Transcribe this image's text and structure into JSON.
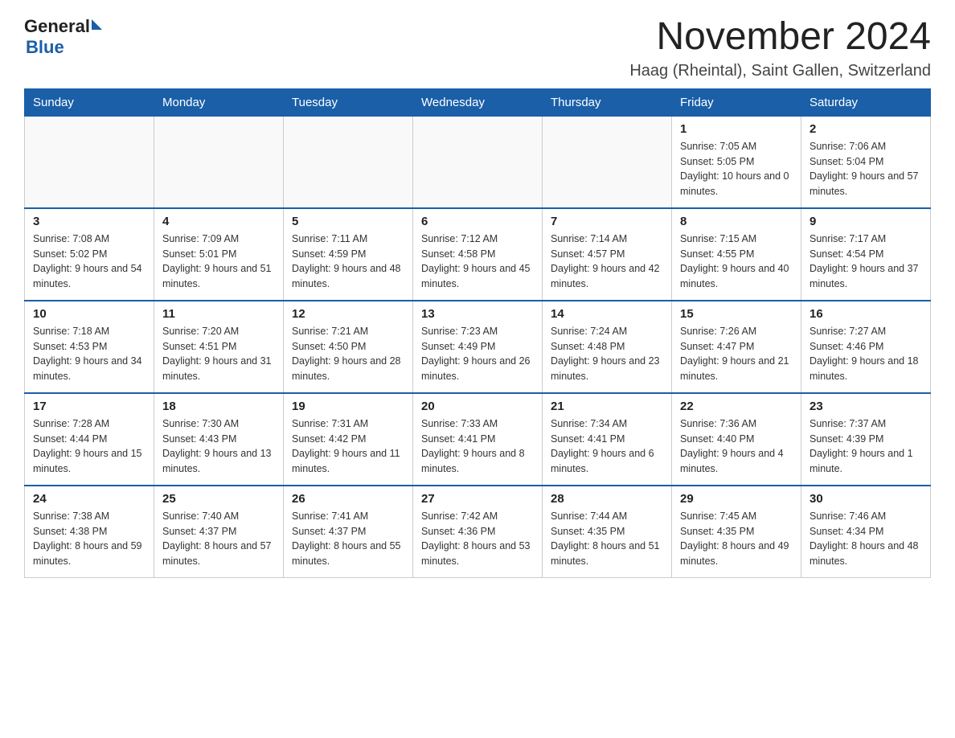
{
  "header": {
    "logo_general": "General",
    "logo_blue": "Blue",
    "month_title": "November 2024",
    "location": "Haag (Rheintal), Saint Gallen, Switzerland"
  },
  "weekdays": [
    "Sunday",
    "Monday",
    "Tuesday",
    "Wednesday",
    "Thursday",
    "Friday",
    "Saturday"
  ],
  "weeks": [
    [
      {
        "day": "",
        "info": ""
      },
      {
        "day": "",
        "info": ""
      },
      {
        "day": "",
        "info": ""
      },
      {
        "day": "",
        "info": ""
      },
      {
        "day": "",
        "info": ""
      },
      {
        "day": "1",
        "info": "Sunrise: 7:05 AM\nSunset: 5:05 PM\nDaylight: 10 hours and 0 minutes."
      },
      {
        "day": "2",
        "info": "Sunrise: 7:06 AM\nSunset: 5:04 PM\nDaylight: 9 hours and 57 minutes."
      }
    ],
    [
      {
        "day": "3",
        "info": "Sunrise: 7:08 AM\nSunset: 5:02 PM\nDaylight: 9 hours and 54 minutes."
      },
      {
        "day": "4",
        "info": "Sunrise: 7:09 AM\nSunset: 5:01 PM\nDaylight: 9 hours and 51 minutes."
      },
      {
        "day": "5",
        "info": "Sunrise: 7:11 AM\nSunset: 4:59 PM\nDaylight: 9 hours and 48 minutes."
      },
      {
        "day": "6",
        "info": "Sunrise: 7:12 AM\nSunset: 4:58 PM\nDaylight: 9 hours and 45 minutes."
      },
      {
        "day": "7",
        "info": "Sunrise: 7:14 AM\nSunset: 4:57 PM\nDaylight: 9 hours and 42 minutes."
      },
      {
        "day": "8",
        "info": "Sunrise: 7:15 AM\nSunset: 4:55 PM\nDaylight: 9 hours and 40 minutes."
      },
      {
        "day": "9",
        "info": "Sunrise: 7:17 AM\nSunset: 4:54 PM\nDaylight: 9 hours and 37 minutes."
      }
    ],
    [
      {
        "day": "10",
        "info": "Sunrise: 7:18 AM\nSunset: 4:53 PM\nDaylight: 9 hours and 34 minutes."
      },
      {
        "day": "11",
        "info": "Sunrise: 7:20 AM\nSunset: 4:51 PM\nDaylight: 9 hours and 31 minutes."
      },
      {
        "day": "12",
        "info": "Sunrise: 7:21 AM\nSunset: 4:50 PM\nDaylight: 9 hours and 28 minutes."
      },
      {
        "day": "13",
        "info": "Sunrise: 7:23 AM\nSunset: 4:49 PM\nDaylight: 9 hours and 26 minutes."
      },
      {
        "day": "14",
        "info": "Sunrise: 7:24 AM\nSunset: 4:48 PM\nDaylight: 9 hours and 23 minutes."
      },
      {
        "day": "15",
        "info": "Sunrise: 7:26 AM\nSunset: 4:47 PM\nDaylight: 9 hours and 21 minutes."
      },
      {
        "day": "16",
        "info": "Sunrise: 7:27 AM\nSunset: 4:46 PM\nDaylight: 9 hours and 18 minutes."
      }
    ],
    [
      {
        "day": "17",
        "info": "Sunrise: 7:28 AM\nSunset: 4:44 PM\nDaylight: 9 hours and 15 minutes."
      },
      {
        "day": "18",
        "info": "Sunrise: 7:30 AM\nSunset: 4:43 PM\nDaylight: 9 hours and 13 minutes."
      },
      {
        "day": "19",
        "info": "Sunrise: 7:31 AM\nSunset: 4:42 PM\nDaylight: 9 hours and 11 minutes."
      },
      {
        "day": "20",
        "info": "Sunrise: 7:33 AM\nSunset: 4:41 PM\nDaylight: 9 hours and 8 minutes."
      },
      {
        "day": "21",
        "info": "Sunrise: 7:34 AM\nSunset: 4:41 PM\nDaylight: 9 hours and 6 minutes."
      },
      {
        "day": "22",
        "info": "Sunrise: 7:36 AM\nSunset: 4:40 PM\nDaylight: 9 hours and 4 minutes."
      },
      {
        "day": "23",
        "info": "Sunrise: 7:37 AM\nSunset: 4:39 PM\nDaylight: 9 hours and 1 minute."
      }
    ],
    [
      {
        "day": "24",
        "info": "Sunrise: 7:38 AM\nSunset: 4:38 PM\nDaylight: 8 hours and 59 minutes."
      },
      {
        "day": "25",
        "info": "Sunrise: 7:40 AM\nSunset: 4:37 PM\nDaylight: 8 hours and 57 minutes."
      },
      {
        "day": "26",
        "info": "Sunrise: 7:41 AM\nSunset: 4:37 PM\nDaylight: 8 hours and 55 minutes."
      },
      {
        "day": "27",
        "info": "Sunrise: 7:42 AM\nSunset: 4:36 PM\nDaylight: 8 hours and 53 minutes."
      },
      {
        "day": "28",
        "info": "Sunrise: 7:44 AM\nSunset: 4:35 PM\nDaylight: 8 hours and 51 minutes."
      },
      {
        "day": "29",
        "info": "Sunrise: 7:45 AM\nSunset: 4:35 PM\nDaylight: 8 hours and 49 minutes."
      },
      {
        "day": "30",
        "info": "Sunrise: 7:46 AM\nSunset: 4:34 PM\nDaylight: 8 hours and 48 minutes."
      }
    ]
  ]
}
